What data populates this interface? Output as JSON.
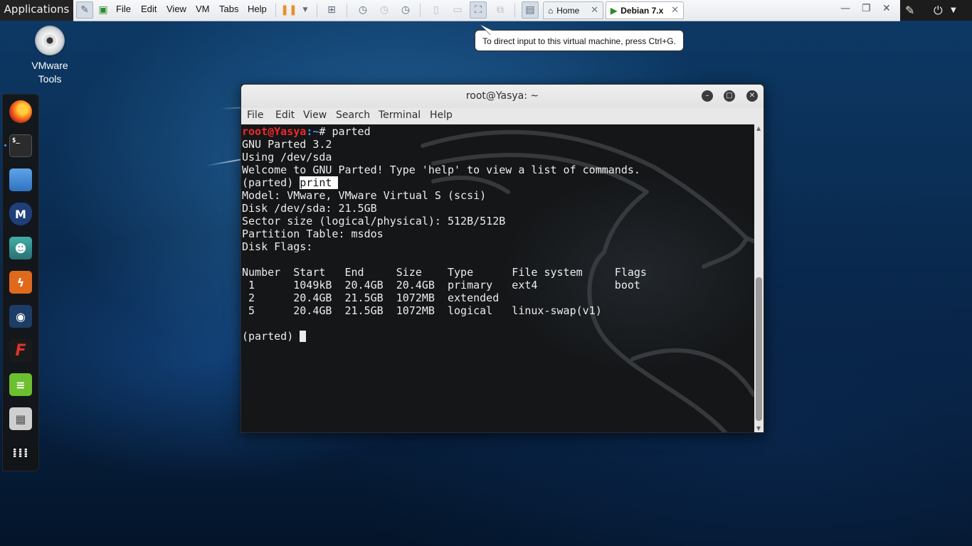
{
  "topbar": {
    "applications_label": "Applications"
  },
  "vmware": {
    "menu": [
      "File",
      "Edit",
      "View",
      "VM",
      "Tabs",
      "Help"
    ],
    "tabs": [
      {
        "label": "Home"
      },
      {
        "label": "Debian 7.x"
      }
    ],
    "tooltip": "To direct input to this virtual machine, press Ctrl+G."
  },
  "desktop": {
    "icon_label_line1": "VMware",
    "icon_label_line2": "Tools"
  },
  "dock": {
    "items": [
      "firefox",
      "terminal",
      "files",
      "metasploit",
      "armitage",
      "burpsuite",
      "maltego",
      "faraday",
      "leafpad",
      "cherrytree",
      "show-applications"
    ]
  },
  "terminal": {
    "title": "root@Yasya: ~",
    "menu": [
      "File",
      "Edit",
      "View",
      "Search",
      "Terminal",
      "Help"
    ],
    "prompt_user": "root@Yasya",
    "prompt_path": ":~",
    "prompt_symbol": "# ",
    "command": "parted",
    "lines": [
      "GNU Parted 3.2",
      "Using /dev/sda",
      "Welcome to GNU Parted! Type 'help' to view a list of commands."
    ],
    "parted_prompt": "(parted) ",
    "print_cmd": "print",
    "info_lines": [
      "Model: VMware, VMware Virtual S (scsi)",
      "Disk /dev/sda: 21.5GB",
      "Sector size (logical/physical): 512B/512B",
      "Partition Table: msdos",
      "Disk Flags:"
    ],
    "table_header": "Number  Start   End     Size    Type      File system     Flags",
    "table_rows": [
      " 1      1049kB  20.4GB  20.4GB  primary   ext4            boot",
      " 2      20.4GB  21.5GB  1072MB  extended",
      " 5      20.4GB  21.5GB  1072MB  logical   linux-swap(v1)"
    ],
    "final_prompt": "(parted) "
  }
}
